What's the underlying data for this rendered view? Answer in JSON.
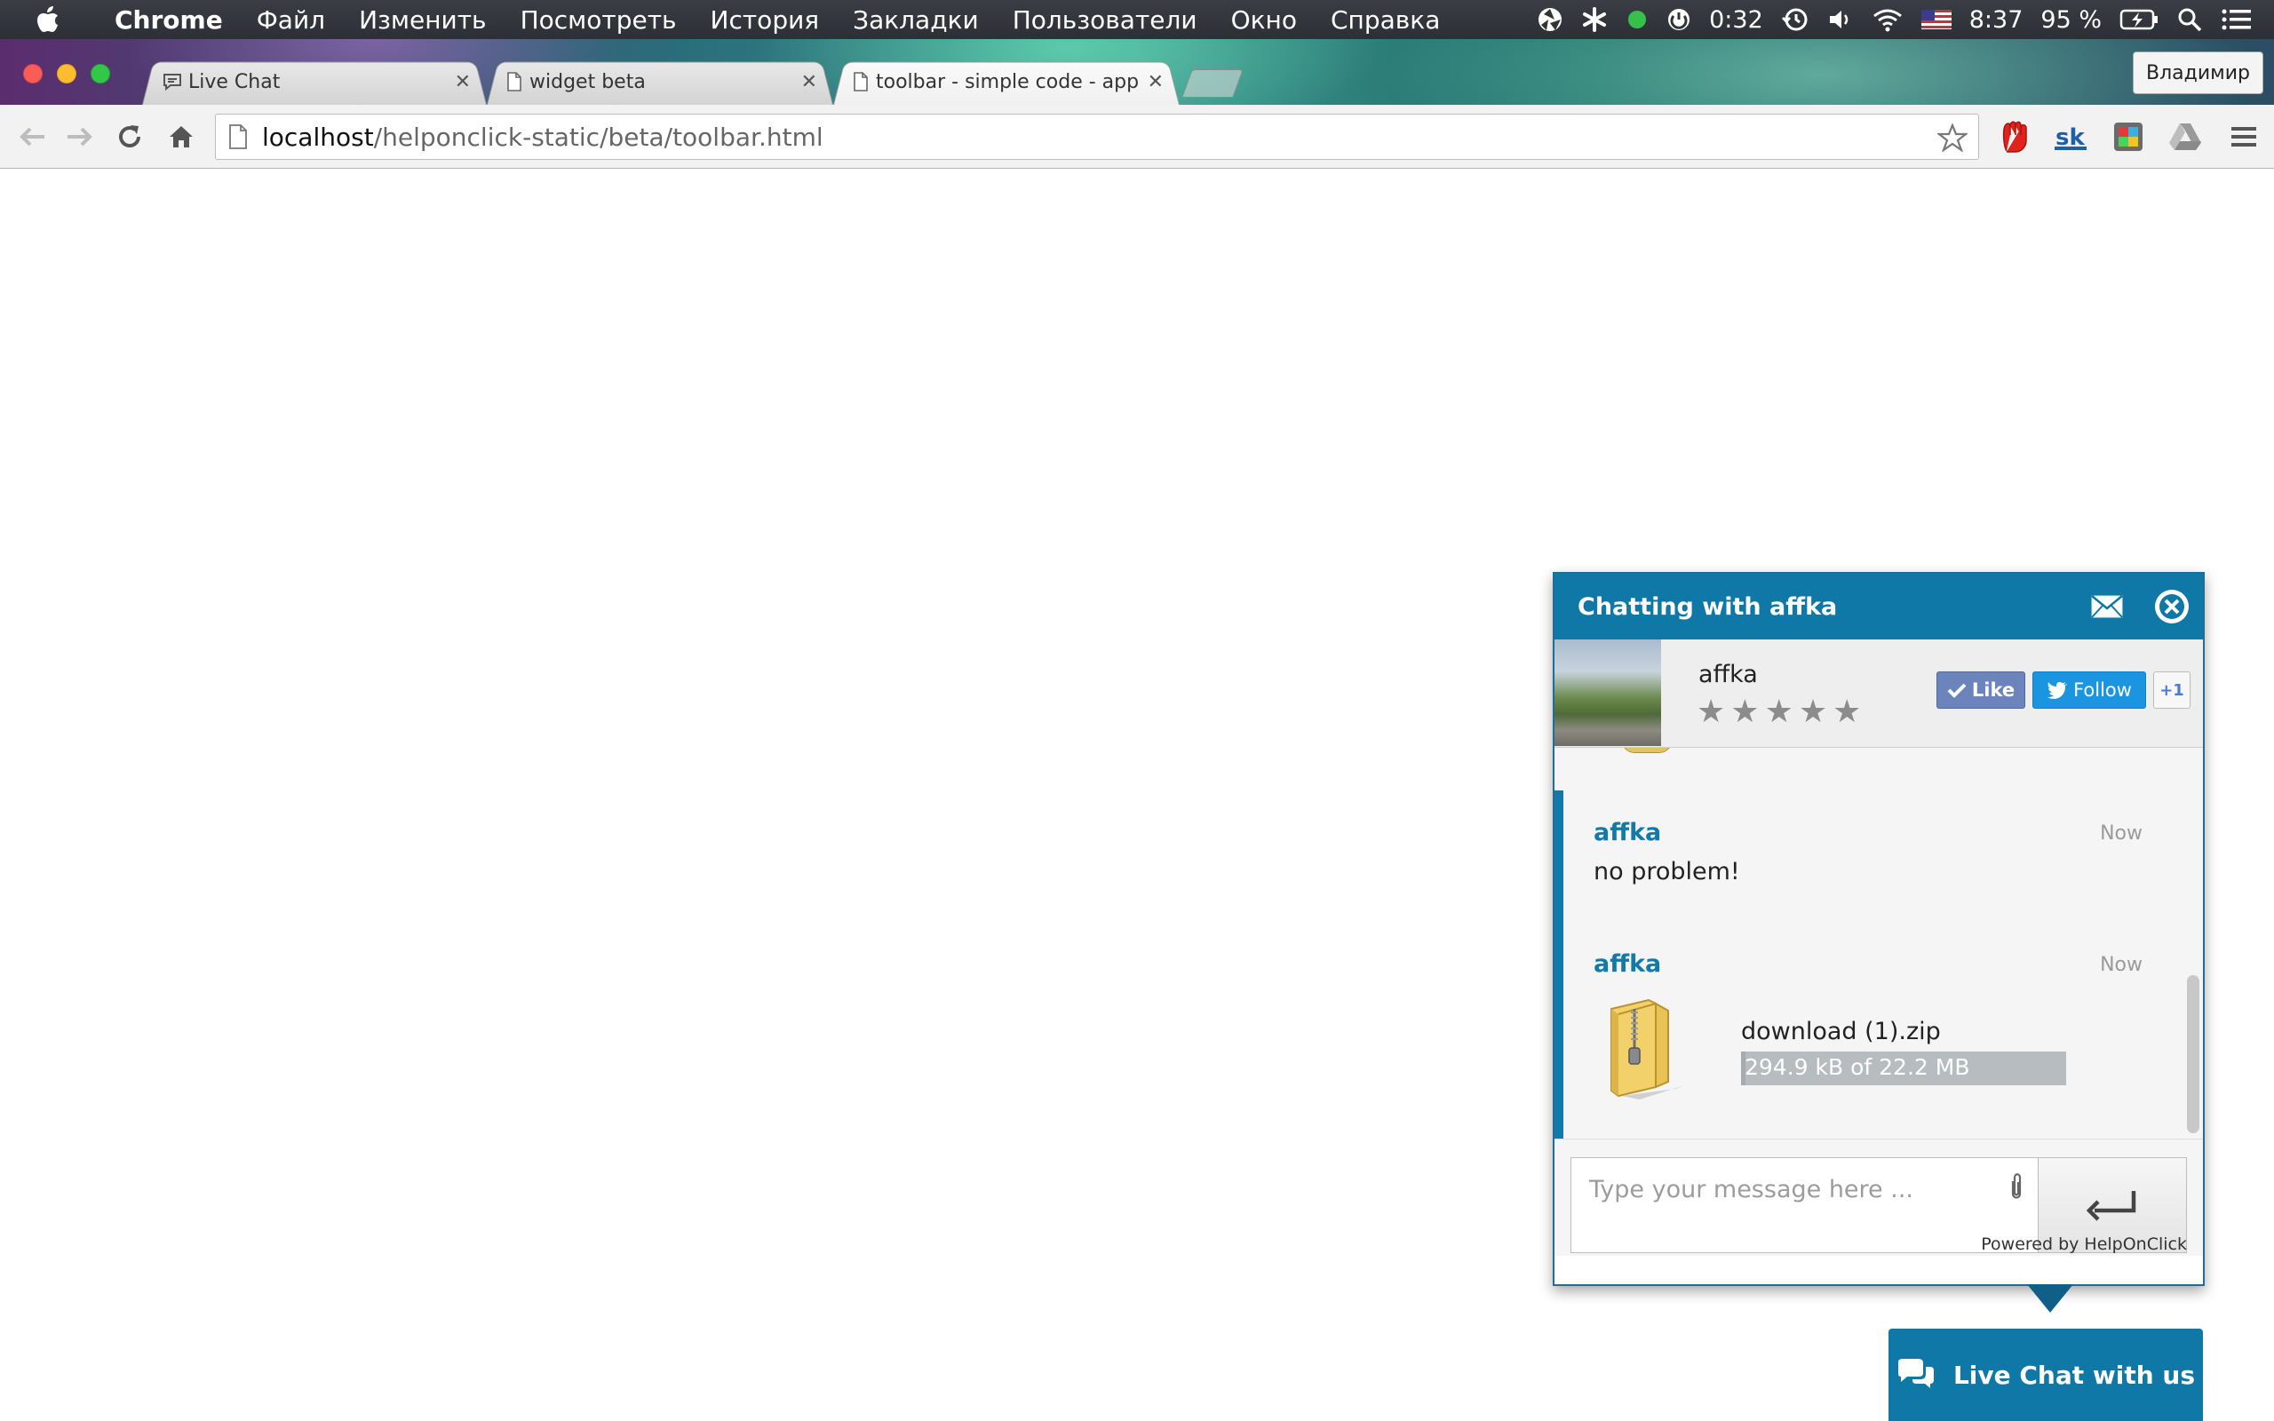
{
  "menubar": {
    "app": "Chrome",
    "items": [
      "Файл",
      "Изменить",
      "Посмотреть",
      "История",
      "Закладки",
      "Пользователи",
      "Окно",
      "Справка"
    ],
    "timer": "0:32",
    "clock": "8:37",
    "battery": "95 %"
  },
  "browser": {
    "tabs": [
      {
        "title": "Live Chat"
      },
      {
        "title": "widget beta"
      },
      {
        "title": "toolbar - simple code - app"
      }
    ],
    "profile": "Владимир",
    "url_host": "localhost",
    "url_path": "/helponclick-static/beta/toolbar.html"
  },
  "chat": {
    "header_title": "Chatting with affka",
    "agent_name": "affka",
    "rating": 0,
    "rating_max": 5,
    "like_label": "Like",
    "follow_label": "Follow",
    "plusone_label": "+1",
    "messages": [
      {
        "author": "affka",
        "time": "Now",
        "text": "no problem!"
      },
      {
        "author": "affka",
        "time": "Now",
        "file_name": "download (1).zip",
        "progress_text": "294.9 kB of 22.2 MB",
        "progress_fraction": 0.013
      }
    ],
    "input_placeholder": "Type your message here ...",
    "powered_by": "Powered by HelpOnClick",
    "launcher_label": "Live Chat with us"
  },
  "colors": {
    "brand": "#0f78a6",
    "like": "#6b84bc",
    "twitter": "#1b95e0"
  }
}
